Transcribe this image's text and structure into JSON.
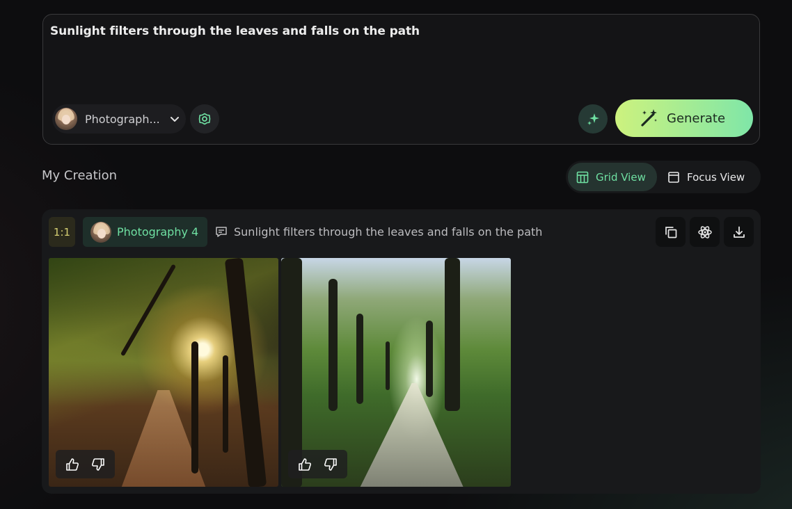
{
  "prompt": {
    "text": "Sunlight filters through the leaves and falls on the path",
    "model_label": "Photograph...",
    "generate_label": "Generate"
  },
  "section": {
    "title": "My Creation",
    "view_grid": "Grid View",
    "view_focus": "Focus View",
    "active_view": "Grid View"
  },
  "creation": {
    "ratio": "1:1",
    "style": "Photography 4",
    "prompt": "Sunlight filters through the leaves and falls on the path",
    "images": [
      {
        "name": "sunlit-forest-path-1"
      },
      {
        "name": "tree-lined-path-2"
      }
    ]
  },
  "colors": {
    "accent": "#6fe0a2",
    "generate_gradient_start": "#cdf27e",
    "generate_gradient_end": "#7fe6a8",
    "ratio_tag": "#d5cf73"
  },
  "icons": [
    "chevron-down-icon",
    "settings-gear-icon",
    "sparkle-icon",
    "magic-wand-icon",
    "grid-view-icon",
    "focus-view-icon",
    "prompt-icon",
    "copy-icon",
    "atom-icon",
    "download-icon",
    "thumbs-up-icon",
    "thumbs-down-icon"
  ]
}
